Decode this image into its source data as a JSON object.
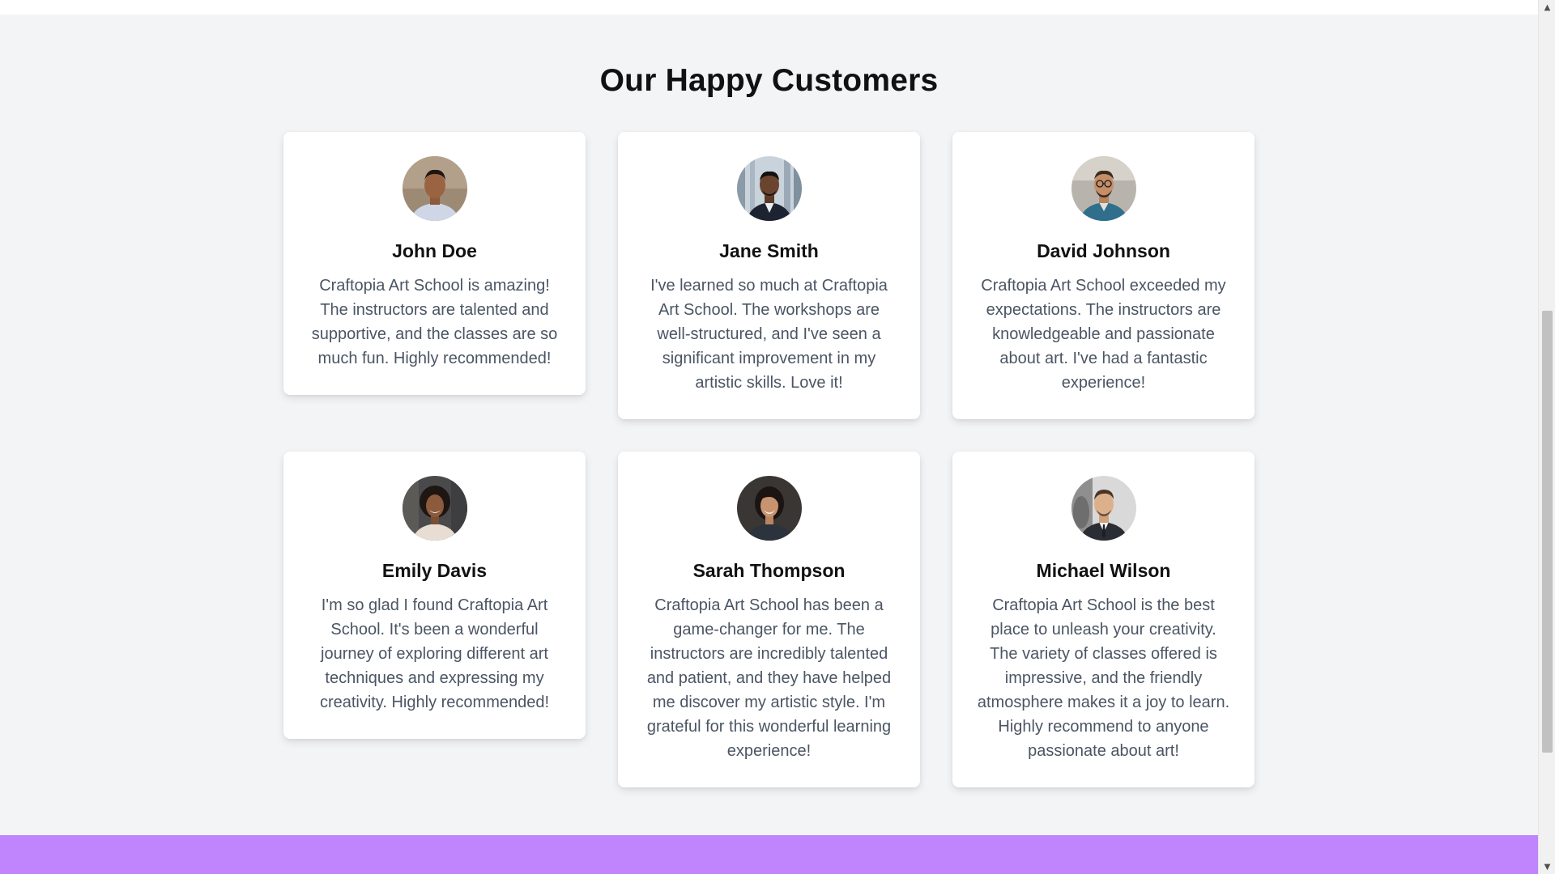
{
  "section": {
    "title": "Our Happy Customers"
  },
  "testimonials": [
    {
      "name": "John Doe",
      "quote": "Craftopia Art School is amazing! The instructors are talented and supportive, and the classes are so much fun. Highly recommended!",
      "avatar": "man-smiling-avatar"
    },
    {
      "name": "Jane Smith",
      "quote": "I've learned so much at Craftopia Art School. The workshops are well-structured, and I've seen a significant improvement in my artistic skills. Love it!",
      "avatar": "man-office-avatar"
    },
    {
      "name": "David Johnson",
      "quote": "Craftopia Art School exceeded my expectations. The instructors are knowledgeable and passionate about art. I've had a fantastic experience!",
      "avatar": "man-glasses-avatar"
    },
    {
      "name": "Emily Davis",
      "quote": "I'm so glad I found Craftopia Art School. It's been a wonderful journey of exploring different art techniques and expressing my creativity. Highly recommended!",
      "avatar": "woman-curly-hair-avatar"
    },
    {
      "name": "Sarah Thompson",
      "quote": "Craftopia Art School has been a game-changer for me. The instructors are incredibly talented and patient, and they have helped me discover my artistic style. I'm grateful for this wonderful learning experience!",
      "avatar": "woman-dark-hair-avatar"
    },
    {
      "name": "Michael Wilson",
      "quote": "Craftopia Art School is the best place to unleash your creativity. The variety of classes offered is impressive, and the friendly atmosphere makes it a joy to learn. Highly recommend to anyone passionate about art!",
      "avatar": "man-suit-avatar"
    }
  ],
  "colors": {
    "page_background": "#f3f4f6",
    "card_background": "#ffffff",
    "footer_band": "#c084fc",
    "heading_text": "#111111",
    "body_text": "#4b5563"
  },
  "icons": {
    "scroll_up": "▲",
    "scroll_down": "▼"
  }
}
